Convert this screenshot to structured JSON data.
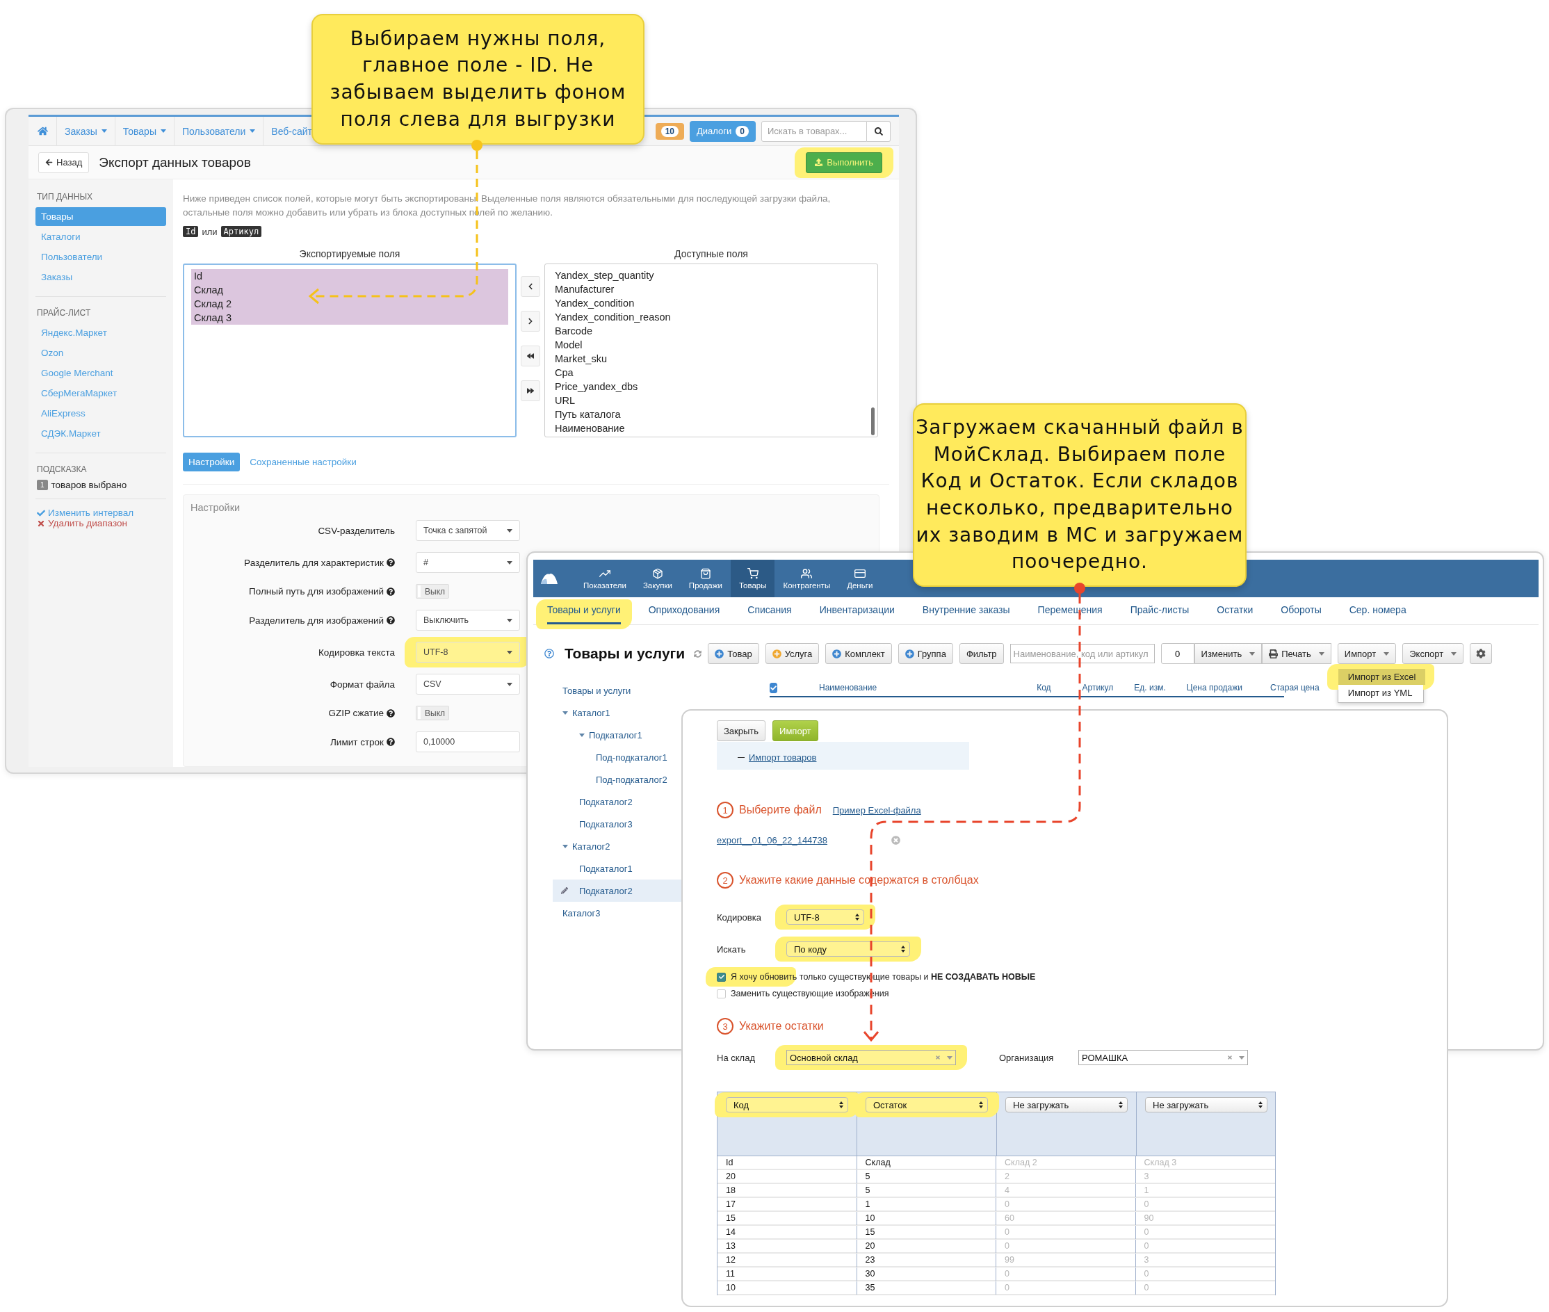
{
  "callouts": [
    {
      "lines": [
        "Выбираем нужны поля,",
        "главное поле - ID. Не",
        "забываем выделить фоном",
        "поля слева для выгрузки"
      ]
    },
    {
      "lines": [
        "Загружаем скачанный файл в",
        "МойСклад. Выбираем поле",
        "Код и Остаток. Если складов",
        "несколько, предварительно",
        "их заводим в МС и загружаем",
        "поочередно."
      ]
    }
  ],
  "export_window": {
    "nav": [
      {
        "label": "Заказы"
      },
      {
        "label": "Товары"
      },
      {
        "label": "Пользователи"
      },
      {
        "label": "Веб-сайт"
      }
    ],
    "badge": "10",
    "dialogs": {
      "label": "Диалоги",
      "count": "0"
    },
    "search": {
      "placeholder": "Искать в товарах..."
    },
    "back_button": "Назад",
    "title": "Экспорт данных товаров",
    "run_button": {
      "label": "Выполнить",
      "highlighted": true
    },
    "sidebar": {
      "sections": [
        {
          "heading": "ТИП ДАННЫХ",
          "items": [
            {
              "label": "Товары",
              "selected": true
            },
            {
              "label": "Каталоги",
              "selected": false
            },
            {
              "label": "Пользователи",
              "selected": false
            },
            {
              "label": "Заказы",
              "selected": false
            }
          ]
        },
        {
          "heading": "ПРАЙС-ЛИСТ",
          "items": [
            {
              "label": "Яндекс.Маркет",
              "selected": false
            },
            {
              "label": "Ozon",
              "selected": false
            },
            {
              "label": "Google Merchant",
              "selected": false
            },
            {
              "label": "СберМегаМаркет",
              "selected": false
            },
            {
              "label": "AliExpress",
              "selected": false
            },
            {
              "label": "СДЭК.Маркет",
              "selected": false
            }
          ]
        }
      ],
      "hint": {
        "heading": "ПОДСКАЗКА",
        "count": "1",
        "text": "товаров выбрано"
      },
      "actions": [
        {
          "kind": "ok",
          "label": "Изменить интервал"
        },
        {
          "kind": "delete",
          "label": "Удалить диапазон"
        }
      ]
    },
    "intro": "Ниже приведен список полей, которые могут быть экспортированы. Выделенные поля являются обязательными для последующей загрузки файла, остальные поля можно добавить или убрать из блока доступных полей по желанию.",
    "key_fields": {
      "codes": [
        "Id",
        "Артикул"
      ],
      "joiner": "или"
    },
    "exported": {
      "title": "Экспортируемые поля",
      "items": [
        {
          "label": "Id",
          "selected": true
        },
        {
          "label": "Склад",
          "selected": true
        },
        {
          "label": "Склад 2",
          "selected": true
        },
        {
          "label": "Склад 3",
          "selected": true
        }
      ]
    },
    "available": {
      "title": "Доступные поля",
      "items": [
        {
          "label": "Yandex_step_quantity",
          "selected": false
        },
        {
          "label": "Manufacturer",
          "selected": false
        },
        {
          "label": "Yandex_condition",
          "selected": false
        },
        {
          "label": "Yandex_condition_reason",
          "selected": false
        },
        {
          "label": "Barcode",
          "selected": false
        },
        {
          "label": "Model",
          "selected": false
        },
        {
          "label": "Market_sku",
          "selected": false
        },
        {
          "label": "Cpa",
          "selected": false
        },
        {
          "label": "Price_yandex_dbs",
          "selected": false
        },
        {
          "label": "URL",
          "selected": false
        },
        {
          "label": "Путь каталога",
          "selected": false
        },
        {
          "label": "Наименование",
          "selected": false
        }
      ]
    },
    "tabs": [
      {
        "label": "Настройки",
        "selected": true
      },
      {
        "label": "Сохраненные настройки",
        "selected": false
      }
    ],
    "settings": {
      "title": "Настройки",
      "rows": [
        {
          "kind": "select",
          "label": "CSV-разделитель",
          "value": "Точка с запятой",
          "help": false,
          "highlighted": false
        },
        {
          "kind": "select",
          "label": "Разделитель для характеристик",
          "value": "#",
          "help": true,
          "highlighted": false
        },
        {
          "kind": "toggle",
          "label": "Полный путь для изображений",
          "value": "Выкл",
          "on": false,
          "help": true,
          "highlighted": false
        },
        {
          "kind": "select",
          "label": "Разделитель для изображений",
          "value": "Выключить",
          "help": true,
          "highlighted": false
        },
        {
          "kind": "select",
          "label": "Кодировка текста",
          "value": "UTF-8",
          "help": false,
          "highlighted": true
        },
        {
          "kind": "select",
          "label": "Формат файла",
          "value": "CSV",
          "help": false,
          "highlighted": false
        },
        {
          "kind": "toggle",
          "label": "GZIP сжатие",
          "value": "Выкл",
          "on": false,
          "help": true,
          "highlighted": false
        },
        {
          "kind": "input",
          "label": "Лимит строк",
          "value": "0,10000",
          "help": true,
          "highlighted": false
        }
      ]
    }
  },
  "store_window": {
    "topnav": [
      {
        "label": "Показатели",
        "selected": false
      },
      {
        "label": "Закупки",
        "selected": false
      },
      {
        "label": "Продажи",
        "selected": false
      },
      {
        "label": "Товары",
        "selected": true
      },
      {
        "label": "Контрагенты",
        "selected": false
      },
      {
        "label": "Деньги",
        "selected": false
      }
    ],
    "subnav": [
      {
        "label": "Товары и услуги",
        "selected": true,
        "highlighted": true
      },
      {
        "label": "Оприходования",
        "selected": false,
        "highlighted": false
      },
      {
        "label": "Списания",
        "selected": false,
        "highlighted": false
      },
      {
        "label": "Инвентаризации",
        "selected": false,
        "highlighted": false
      },
      {
        "label": "Внутренние заказы",
        "selected": false,
        "highlighted": false
      },
      {
        "label": "Перемещения",
        "selected": false,
        "highlighted": false
      },
      {
        "label": "Прайс-листы",
        "selected": false,
        "highlighted": false
      },
      {
        "label": "Остатки",
        "selected": false,
        "highlighted": false
      },
      {
        "label": "Обороты",
        "selected": false,
        "highlighted": false
      },
      {
        "label": "Сер. номера",
        "selected": false,
        "highlighted": false
      }
    ],
    "title": "Товары и услуги",
    "create_buttons": [
      {
        "label": "Товар",
        "color": "#3d86d0"
      },
      {
        "label": "Услуга",
        "color": "#f0a830"
      },
      {
        "label": "Комплект",
        "color": "#3d86d0"
      },
      {
        "label": "Группа",
        "color": "#3d86d0"
      }
    ],
    "filter_button": "Фильтр",
    "search": {
      "placeholder": "Наименование, код или артикул"
    },
    "count": "0",
    "menus": [
      {
        "kind": "plain",
        "label": "Изменить"
      },
      {
        "kind": "print",
        "label": "Печать"
      },
      {
        "kind": "plain",
        "label": "Импорт"
      },
      {
        "kind": "plain",
        "label": "Экспорт"
      }
    ],
    "import_menu": [
      {
        "label": "Импорт из Excel",
        "selected": true,
        "highlighted": true
      },
      {
        "label": "Импорт из YML",
        "selected": false,
        "highlighted": false
      }
    ],
    "tree": {
      "title": "Товары и услуги",
      "items": [
        {
          "label": "Каталог1",
          "selected": false,
          "expanded": true,
          "children": [
            {
              "label": "Подкаталог1",
              "selected": false,
              "expanded": true,
              "children": [
                {
                  "label": "Под-подкаталог1",
                  "selected": false
                },
                {
                  "label": "Под-подкаталог2",
                  "selected": false
                }
              ]
            },
            {
              "label": "Подкаталог2",
              "selected": false
            },
            {
              "label": "Подкаталог3",
              "selected": false
            }
          ]
        },
        {
          "label": "Каталог2",
          "selected": false,
          "expanded": true,
          "children": [
            {
              "label": "Подкаталог1",
              "selected": false
            },
            {
              "label": "Подкаталог2",
              "selected": true
            }
          ]
        },
        {
          "label": "Каталог3",
          "selected": false
        }
      ]
    },
    "select_all": {
      "checked": true
    },
    "columns": [
      "Наименование",
      "Код",
      "Артикул",
      "Ед. изм.",
      "Цена продажи",
      "Старая цена"
    ]
  },
  "import_dialog": {
    "close_button": "Закрыть",
    "import_button": "Импорт",
    "help_link": "Импорт товаров",
    "step1": {
      "number": "1",
      "title": "Выберите файл",
      "sample_link": "Пример Excel-файла",
      "file": "export__01_06_22_144738"
    },
    "step2": {
      "number": "2",
      "title": "Укажите какие данные содержатся в столбцах",
      "fields": [
        {
          "label": "Кодировка",
          "value": "UTF-8",
          "highlighted": true
        },
        {
          "label": "Искать",
          "value": "По коду",
          "highlighted": true
        }
      ],
      "options": [
        {
          "label": "Я хочу обновить только существующие товары и **НЕ СОЗДАВАТЬ НОВЫЕ**",
          "checked": true,
          "highlighted": true
        },
        {
          "label": "Заменить существующие изображения",
          "checked": false,
          "highlighted": false
        }
      ]
    },
    "step3": {
      "number": "3",
      "title": "Укажите остатки",
      "warehouse": {
        "label": "На склад",
        "value": "Основной склад",
        "highlighted": true
      },
      "organization": {
        "label": "Организация",
        "value": "РОМАШКА",
        "highlighted": false
      }
    },
    "mapping": {
      "columns": [
        {
          "value": "Код",
          "disabled": false,
          "highlighted": true
        },
        {
          "value": "Остаток",
          "disabled": false,
          "highlighted": true
        },
        {
          "value": "Не загружать",
          "disabled": true,
          "highlighted": false
        },
        {
          "value": "Не загружать",
          "disabled": true,
          "highlighted": false
        }
      ],
      "rows": [
        [
          "Id",
          "Склад",
          "Склад 2",
          "Склад 3"
        ],
        [
          "20",
          "5",
          "2",
          "3"
        ],
        [
          "18",
          "5",
          "4",
          "1"
        ],
        [
          "17",
          "1",
          "0",
          "0"
        ],
        [
          "15",
          "10",
          "60",
          "90"
        ],
        [
          "14",
          "15",
          "0",
          "0"
        ],
        [
          "13",
          "20",
          "0",
          "0"
        ],
        [
          "12",
          "23",
          "99",
          "3"
        ],
        [
          "11",
          "30",
          "0",
          "0"
        ],
        [
          "10",
          "35",
          "0",
          "0"
        ]
      ]
    }
  }
}
